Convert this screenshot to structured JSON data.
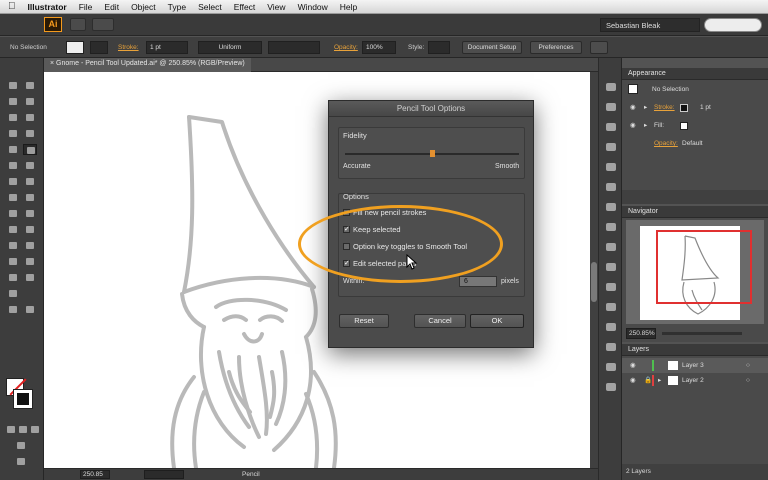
{
  "menubar": {
    "app_name": "Illustrator",
    "items": [
      "File",
      "Edit",
      "Object",
      "Type",
      "Select",
      "Effect",
      "View",
      "Window",
      "Help"
    ]
  },
  "appbar": {
    "logo": "Ai",
    "user": "Sebastian Bleak"
  },
  "controlbar": {
    "selection": "No Selection",
    "stroke_label": "Stroke:",
    "stroke_value": "1 pt",
    "profile": "Uniform",
    "opacity_label": "Opacity:",
    "opacity_value": "100%",
    "style_label": "Style:",
    "doc_setup": "Document Setup",
    "preferences": "Preferences"
  },
  "document": {
    "tab_title": "Gnome - Pencil Tool Updated.ai* @ 250.85% (RGB/Preview)",
    "zoom": "250.85",
    "status_tool": "Pencil"
  },
  "dialog": {
    "title": "Pencil Tool Options",
    "fidelity_label": "Fidelity",
    "accurate_label": "Accurate",
    "smooth_label": "Smooth",
    "fidelity_value": 0.5,
    "options_label": "Options",
    "options": [
      {
        "label": "Fill new pencil strokes",
        "checked": false
      },
      {
        "label": "Keep selected",
        "checked": true
      },
      {
        "label": "Option key toggles to Smooth Tool",
        "checked": false
      },
      {
        "label": "Edit selected paths",
        "checked": true
      }
    ],
    "within_label": "Within:",
    "within_value": "6",
    "within_unit": "pixels",
    "reset": "Reset",
    "cancel": "Cancel",
    "ok": "OK"
  },
  "appearance": {
    "title": "Appearance",
    "no_selection": "No Selection",
    "stroke_label": "Stroke:",
    "stroke_value": "1 pt",
    "fill_label": "Fill:",
    "opacity_label": "Opacity:",
    "opacity_value": "Default"
  },
  "navigator": {
    "title": "Navigator",
    "zoom": "250.85%"
  },
  "layers": {
    "title": "Layers",
    "items": [
      {
        "name": "Layer 3",
        "color": "#4fc04f"
      },
      {
        "name": "Layer 2",
        "color": "#e04040"
      }
    ],
    "count": "2 Layers"
  },
  "colors": {
    "highlight": "#f0a020",
    "accent": "#f59a1d"
  }
}
